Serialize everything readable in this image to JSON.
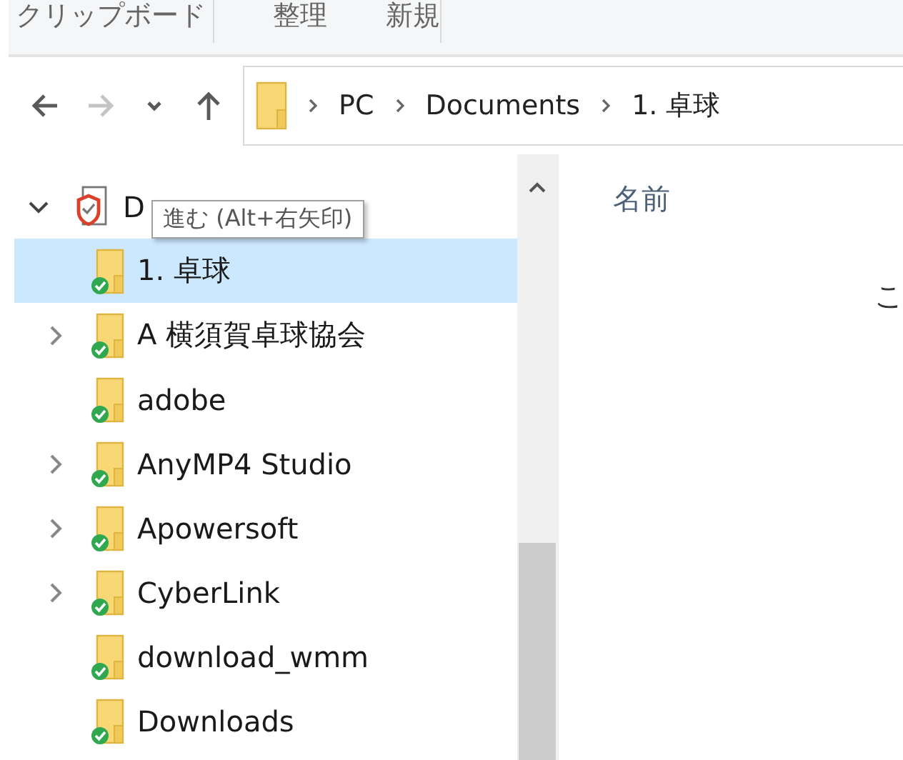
{
  "ribbon": {
    "groups": [
      "クリップボード",
      "整理",
      "新規"
    ]
  },
  "nav_buttons": [
    {
      "kind": "back",
      "disabled": false
    },
    {
      "kind": "forward",
      "disabled": true
    },
    {
      "kind": "recent",
      "disabled": false
    },
    {
      "kind": "up",
      "disabled": false
    }
  ],
  "address": {
    "segments": [
      "PC",
      "Documents",
      "1. 卓球"
    ]
  },
  "tree": {
    "root": {
      "label": "D",
      "expanded": true,
      "children": [
        {
          "label": "1. 卓球",
          "selected": true,
          "has_children": false
        },
        {
          "label": "A 横須賀卓球協会",
          "selected": false,
          "has_children": true
        },
        {
          "label": "adobe",
          "selected": false,
          "has_children": false
        },
        {
          "label": "AnyMP4 Studio",
          "selected": false,
          "has_children": true
        },
        {
          "label": "Apowersoft",
          "selected": false,
          "has_children": true
        },
        {
          "label": "CyberLink",
          "selected": false,
          "has_children": true
        },
        {
          "label": "download_wmm",
          "selected": false,
          "has_children": false
        },
        {
          "label": "Downloads",
          "selected": false,
          "has_children": false
        }
      ]
    }
  },
  "tooltip": {
    "text": "進む (Alt+右矢印)"
  },
  "content": {
    "columns": [
      "名前"
    ],
    "message": "こ"
  }
}
